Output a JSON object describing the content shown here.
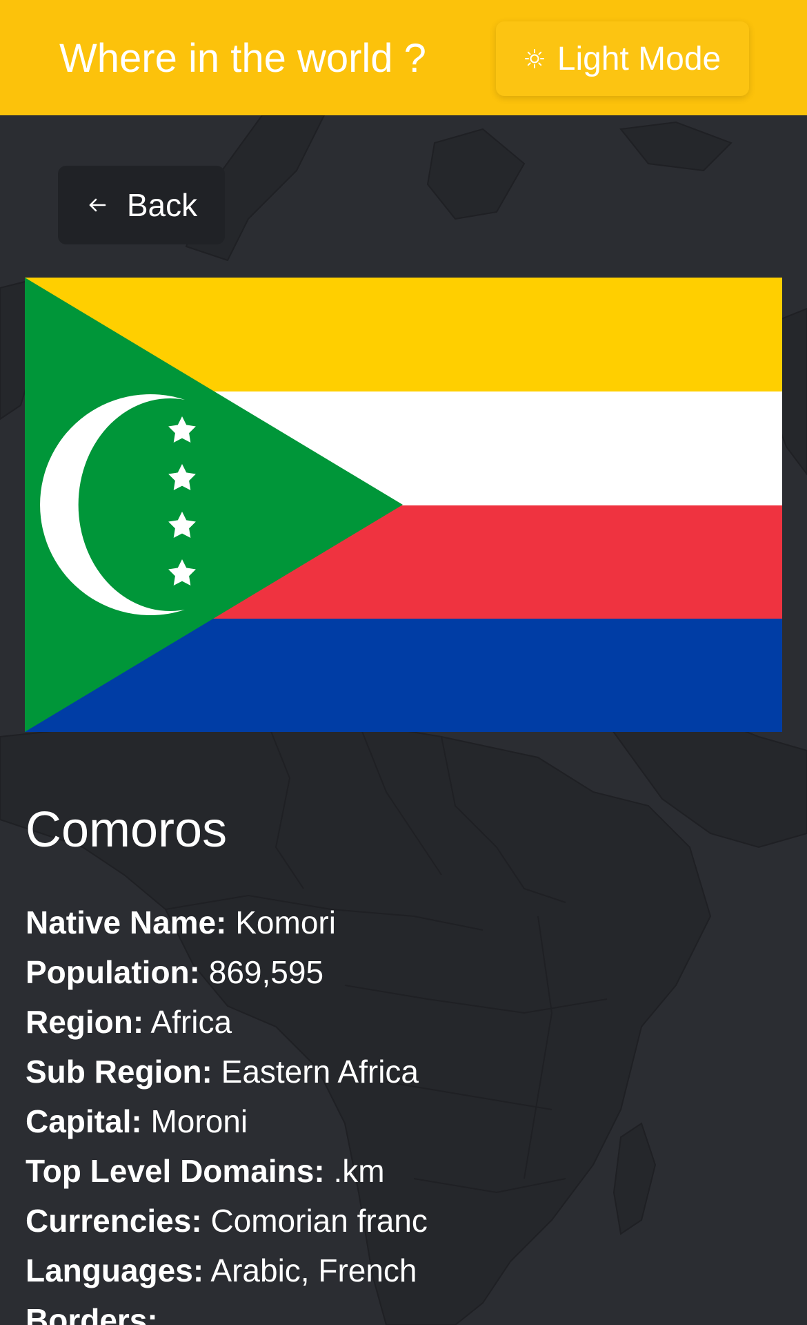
{
  "header": {
    "title": "Where in the world ?",
    "mode_toggle_label": "Light Mode",
    "mode_toggle_icon": "sun-icon",
    "background_color": "#fcc20b"
  },
  "back_button": {
    "label": "Back",
    "icon": "arrow-left-icon"
  },
  "flag": {
    "icon": "comoros-flag",
    "colors": {
      "yellow": "#ffcf00",
      "white": "#ffffff",
      "red": "#ef3340",
      "blue": "#003da5",
      "green": "#009639"
    },
    "star_count": 4
  },
  "country": {
    "name": "Comoros",
    "details": [
      {
        "label": "Native Name:",
        "value": "Komori"
      },
      {
        "label": "Population:",
        "value": "869,595"
      },
      {
        "label": "Region:",
        "value": "Africa"
      },
      {
        "label": "Sub Region:",
        "value": "Eastern Africa"
      },
      {
        "label": "Capital:",
        "value": "Moroni"
      },
      {
        "label": "Top Level Domains:",
        "value": ".km"
      },
      {
        "label": "Currencies:",
        "value": "Comorian franc"
      },
      {
        "label": "Languages:",
        "value": "Arabic, French"
      },
      {
        "label": "Borders:",
        "value": ""
      }
    ]
  },
  "page_background_color": "#2b2d32"
}
